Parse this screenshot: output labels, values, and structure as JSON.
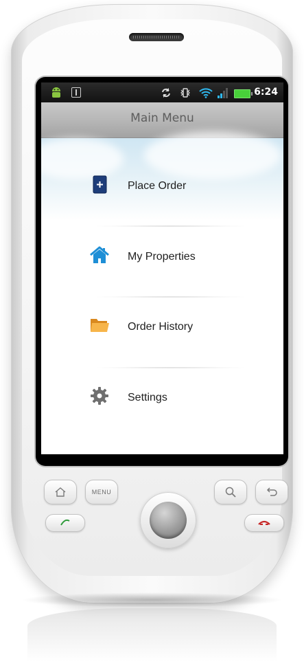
{
  "status_bar": {
    "time": "6:24",
    "battery_color": "#48d13a",
    "icons": [
      "android-icon",
      "usb-icon",
      "sync-icon",
      "vibrate-icon",
      "wifi-icon",
      "signal-icon",
      "battery-icon"
    ]
  },
  "header": {
    "title": "Main Menu"
  },
  "menu": {
    "items": [
      {
        "label": "Place Order",
        "icon": "document-add-icon",
        "icon_color": "#1d3d7a"
      },
      {
        "label": "My Properties",
        "icon": "house-icon",
        "icon_color": "#1f8fd6"
      },
      {
        "label": "Order History",
        "icon": "folder-icon",
        "icon_color": "#f2a53b"
      },
      {
        "label": "Settings",
        "icon": "gear-icon",
        "icon_color": "#6f6f6f"
      }
    ]
  },
  "hardware_buttons": {
    "menu_label": "MENU",
    "call_color": "#2e9a3a",
    "end_color": "#c62828"
  }
}
